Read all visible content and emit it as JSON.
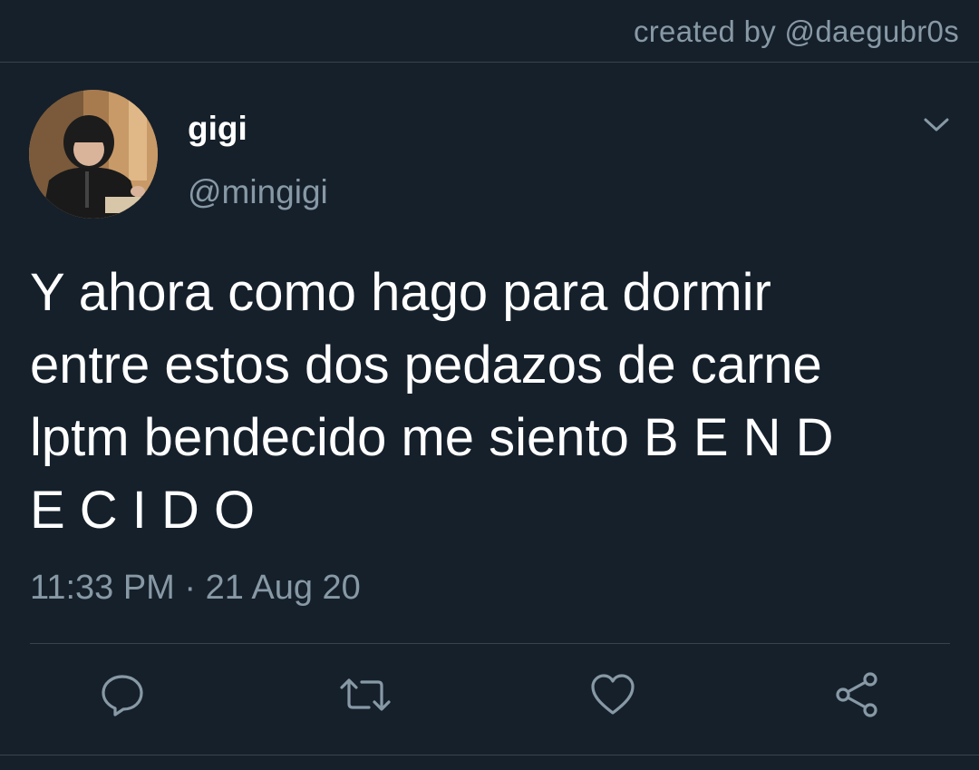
{
  "credit": {
    "text": "created by @daegubr0s"
  },
  "tweet": {
    "author": {
      "name": "gigi",
      "handle": "@mingigi"
    },
    "text": "Y ahora como hago para dormir\nentre estos dos pedazos de carne\nlptm bendecido me siento B E N D\nE C I D O",
    "time": "11:33 PM",
    "date": "21 Aug 20",
    "timestamp_separator": " · "
  },
  "actions": [
    {
      "name": "reply-icon"
    },
    {
      "name": "retweet-icon"
    },
    {
      "name": "like-icon"
    },
    {
      "name": "share-icon"
    }
  ],
  "colors": {
    "background": "#15202b",
    "divider": "#38444d",
    "secondary_text": "#8899a6",
    "primary_text": "#ffffff"
  }
}
